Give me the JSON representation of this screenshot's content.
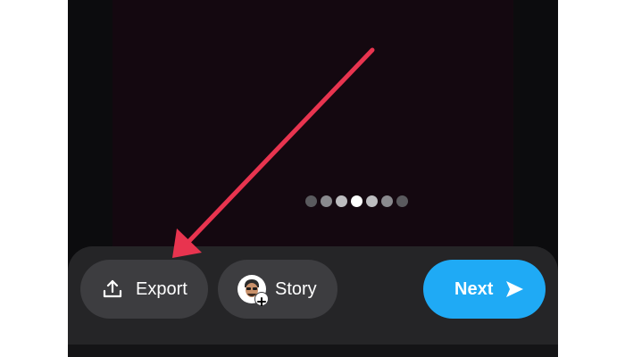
{
  "colors": {
    "preview_bg": "#140810",
    "bar_bg": "#252527",
    "pill_bg": "#3d3d40",
    "next_bg": "#1faaf5",
    "annotation_arrow": "#e8344f"
  },
  "loader": {
    "dots": [
      "#5a5a5e",
      "#8a8a8e",
      "#bdbdc0",
      "#ffffff",
      "#bdbdc0",
      "#8a8a8e",
      "#5a5a5e"
    ],
    "active_index": 3
  },
  "actions": {
    "export": {
      "label": "Export",
      "icon": "export-icon"
    },
    "story": {
      "label": "Story",
      "icon": "bitmoji-avatar-icon"
    },
    "next": {
      "label": "Next",
      "icon": "send-arrow-icon"
    }
  },
  "annotation": {
    "type": "arrow",
    "points_to": "export-button"
  }
}
